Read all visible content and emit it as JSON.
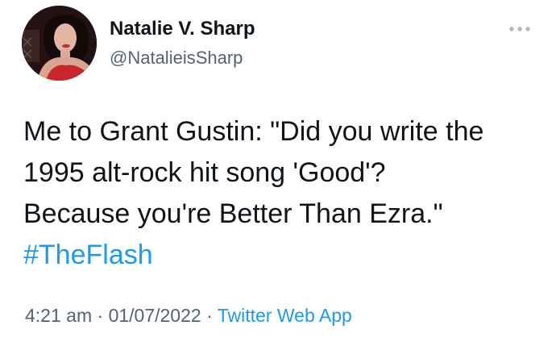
{
  "author": {
    "name": "Natalie V. Sharp",
    "handle": "@NatalieisSharp"
  },
  "tweet": {
    "lines": [
      "Me to Grant Gustin: \"Did you write the",
      "1995 alt-rock hit song 'Good'?",
      "Because you're Better Than Ezra.\""
    ],
    "hashtag": "#TheFlash"
  },
  "meta": {
    "time": "4:21 am",
    "separator": "·",
    "date": "01/07/2022",
    "source": "Twitter Web App"
  },
  "colors": {
    "link": "#1d9bf0",
    "secondary_text": "#536471",
    "primary_text": "#0f1419"
  },
  "icons": {
    "more": "more-horizontal-icon"
  }
}
